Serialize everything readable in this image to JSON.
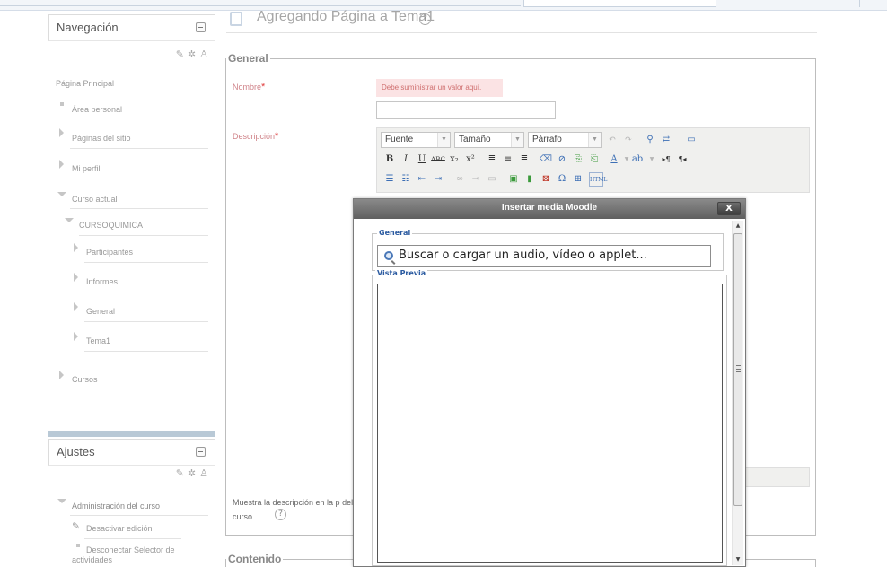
{
  "navigation": {
    "title": "Navegación",
    "items": [
      {
        "label": "Página Principal"
      },
      {
        "label": "Área personal"
      },
      {
        "label": "Páginas del sitio"
      },
      {
        "label": "Mi perfil"
      },
      {
        "label": "Curso actual"
      },
      {
        "label": "CURSOQUIMICA"
      },
      {
        "label": "Participantes"
      },
      {
        "label": "Informes"
      },
      {
        "label": "General"
      },
      {
        "label": "Tema1"
      },
      {
        "label": "Cursos"
      }
    ]
  },
  "settings": {
    "title": "Ajustes",
    "items": [
      {
        "label": "Administración del curso"
      },
      {
        "label": "Desactivar edición"
      },
      {
        "label": "Desconectar Selector de actividades"
      }
    ]
  },
  "page": {
    "title": "Agregando Página a Tema1",
    "help_glyph": "?"
  },
  "form": {
    "general_legend": "General",
    "name_label": "Nombre",
    "required_mark": "*",
    "name_error": "Debe suministrar un valor aquí.",
    "name_value": "",
    "description_label": "Descripción",
    "show_description_label": "Muestra la descripción en la p del curso",
    "content_legend": "Contenido"
  },
  "editor": {
    "font_select": "Fuente",
    "size_select": "Tamaño",
    "format_select": "Párrafo"
  },
  "modal": {
    "title": "Insertar media Moodle",
    "close_label": "X",
    "general_legend": "General",
    "search_label": "Buscar o cargar un audio, vídeo o applet...",
    "preview_legend": "Vista Previa"
  }
}
